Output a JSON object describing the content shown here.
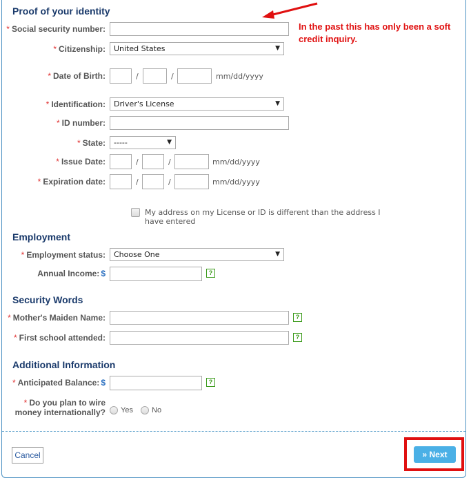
{
  "sections": {
    "identity": "Proof of your identity",
    "employment": "Employment",
    "security": "Security Words",
    "additional": "Additional Information"
  },
  "required_marker": "*",
  "fields": {
    "ssn": {
      "label": "Social security number:",
      "value": ""
    },
    "citizenship": {
      "label": "Citizenship:",
      "selected": "United States"
    },
    "dob": {
      "label": "Date of Birth:",
      "format": "mm/dd/yyyy"
    },
    "identification": {
      "label": "Identification:",
      "selected": "Driver's License"
    },
    "id_number": {
      "label": "ID number:",
      "value": ""
    },
    "state": {
      "label": "State:",
      "selected": "-----"
    },
    "issue_date": {
      "label": "Issue Date:",
      "format": "mm/dd/yyyy"
    },
    "expiration_date": {
      "label": "Expiration date:",
      "format": "mm/dd/yyyy"
    },
    "address_diff": {
      "label": "My address on my License or ID is different than the address I have entered",
      "checked": false
    },
    "employment_status": {
      "label": "Employment status:",
      "selected": "Choose One"
    },
    "annual_income": {
      "label": "Annual Income:",
      "currency": "$",
      "value": ""
    },
    "maiden_name": {
      "label": "Mother's Maiden Name:",
      "value": ""
    },
    "first_school": {
      "label": "First school attended:",
      "value": ""
    },
    "anticipated_balance": {
      "label": "Anticipated Balance:",
      "currency": "$",
      "value": ""
    },
    "wire_money": {
      "label_line1": "Do you plan to wire",
      "label_line2": "money internationally?",
      "options": [
        "Yes",
        "No"
      ]
    }
  },
  "separator": "/",
  "help_glyph": "?",
  "dropdown_glyph": "▼",
  "annotation": {
    "text": "In the past this has only been a soft credit inquiry.",
    "color": "#e01010"
  },
  "buttons": {
    "cancel": "Cancel",
    "next": "Next",
    "next_icon": "»"
  },
  "colors": {
    "heading": "#1a3a6b",
    "required": "#e03030",
    "accent": "#4ab0e6",
    "help": "#3a9a1a"
  }
}
